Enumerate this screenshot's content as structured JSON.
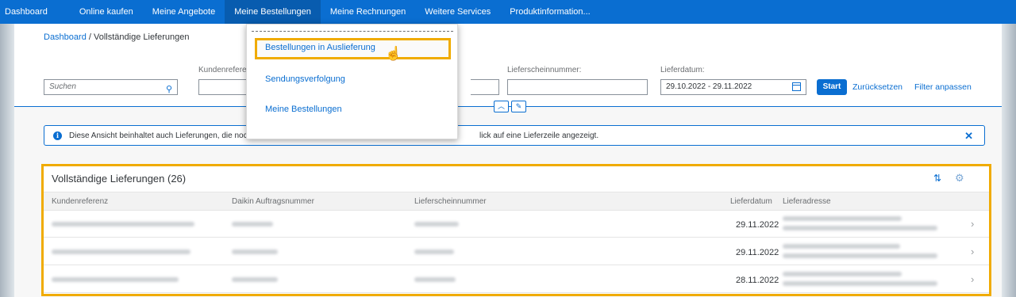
{
  "nav": {
    "items": [
      "Dashboard",
      "Online kaufen",
      "Meine Angebote",
      "Meine Bestellungen",
      "Meine Rechnungen",
      "Weitere Services",
      "Produktinformation..."
    ]
  },
  "breadcrumb": {
    "link": "Dashboard",
    "separator": " / ",
    "current": "Vollständige Lieferungen"
  },
  "filters": {
    "search_placeholder": "Suchen",
    "kundenreferenz_label": "Kundenreferenz:",
    "lieferscheinnummer_label": "Lieferscheinnummer:",
    "lieferdatum_label": "Lieferdatum:",
    "lieferdatum_value": "29.10.2022 - 29.11.2022",
    "start_label": "Start",
    "reset_label": "Zurücksetzen",
    "adapt_label": "Filter anpassen"
  },
  "info": {
    "text_a": "Diese Ansicht beinhaltet auch Lieferungen, die noc",
    "text_b": "lick auf eine Lieferzeile angezeigt."
  },
  "table": {
    "title": "Vollständige Lieferungen (26)",
    "columns": [
      "Kundenreferenz",
      "Daikin Auftragsnummer",
      "Lieferscheinnummer",
      "Lieferdatum",
      "Lieferadresse"
    ],
    "rows": [
      {
        "lieferdatum": "29.11.2022"
      },
      {
        "lieferdatum": "29.11.2022"
      },
      {
        "lieferdatum": "28.11.2022"
      }
    ]
  },
  "dropdown": {
    "items": [
      "Bestellungen in Auslieferung",
      "Sendungsverfolgung",
      "Meine Bestellungen"
    ]
  },
  "icons": {
    "search": "search-icon",
    "calendar": "calendar-icon",
    "info": "info-icon",
    "close": "close-icon",
    "sort": "sort-icon",
    "settings": "gear-icon",
    "chevron": "chevron-right-icon",
    "cursor": "hand-cursor-icon"
  },
  "colors": {
    "primary": "#0a6ed1",
    "highlight": "#f0ab00",
    "nav_bg": "#0a6ed1"
  }
}
